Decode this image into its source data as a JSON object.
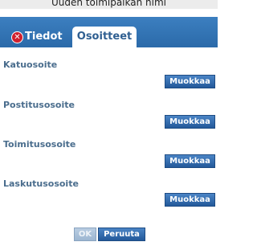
{
  "dialog": {
    "title": "Uuden toimipaikan nimi"
  },
  "tabs": {
    "tiedot": "Tiedot",
    "osoitteet": "Osoitteet"
  },
  "sections": [
    {
      "label": "Katuosoite",
      "button": "Muokkaa"
    },
    {
      "label": "Postitusosoite",
      "button": "Muokkaa"
    },
    {
      "label": "Toimitusosoite",
      "button": "Muokkaa"
    },
    {
      "label": "Laskutusosoite",
      "button": "Muokkaa"
    }
  ],
  "footer": {
    "ok_label": "OK",
    "cancel_label": "Peruuta"
  },
  "colors": {
    "tab_bar": "#2f6fb0",
    "button": "#2f6aa9",
    "label_text": "#4a6d8d",
    "error_icon": "#d0202e"
  },
  "icons": {
    "tiedot_tab": "error-x-icon"
  }
}
